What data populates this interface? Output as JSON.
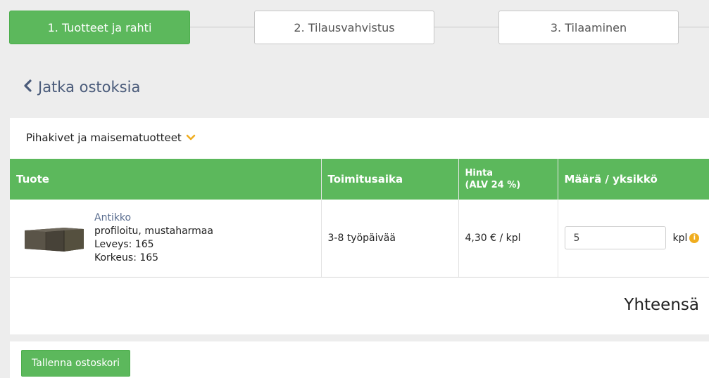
{
  "stepper": {
    "steps": [
      {
        "label": "1. Tuotteet ja rahti"
      },
      {
        "label": "2. Tilausvahvistus"
      },
      {
        "label": "3. Tilaaminen"
      }
    ]
  },
  "continue_link": {
    "label": "Jatka ostoksia",
    "icon": "chevron-left-icon"
  },
  "category": {
    "label": "Pihakivet ja maisematuotteet",
    "icon": "chevron-down-icon"
  },
  "colors": {
    "accent": "#5cb85c",
    "link": "#4a5b7a",
    "warning": "#f0ad1f"
  },
  "table": {
    "headers": {
      "product": "Tuote",
      "delivery": "Toimitusaika",
      "price_line1": "Hinta",
      "price_line2": "(ALV 24 %)",
      "quantity": "Määrä / yksikkö"
    },
    "rows": [
      {
        "name": "Antikko",
        "desc": "profiloitu, mustaharmaa",
        "width": "Leveys: 165",
        "height": "Korkeus: 165",
        "delivery": "3-8 työpäivää",
        "price": "4,30 € / kpl",
        "quantity": "5",
        "unit": "kpl",
        "unit_icon": "info-icon"
      }
    ]
  },
  "total": {
    "label": "Yhteensä"
  },
  "actions": {
    "save_label": "Tallenna ostoskori"
  }
}
